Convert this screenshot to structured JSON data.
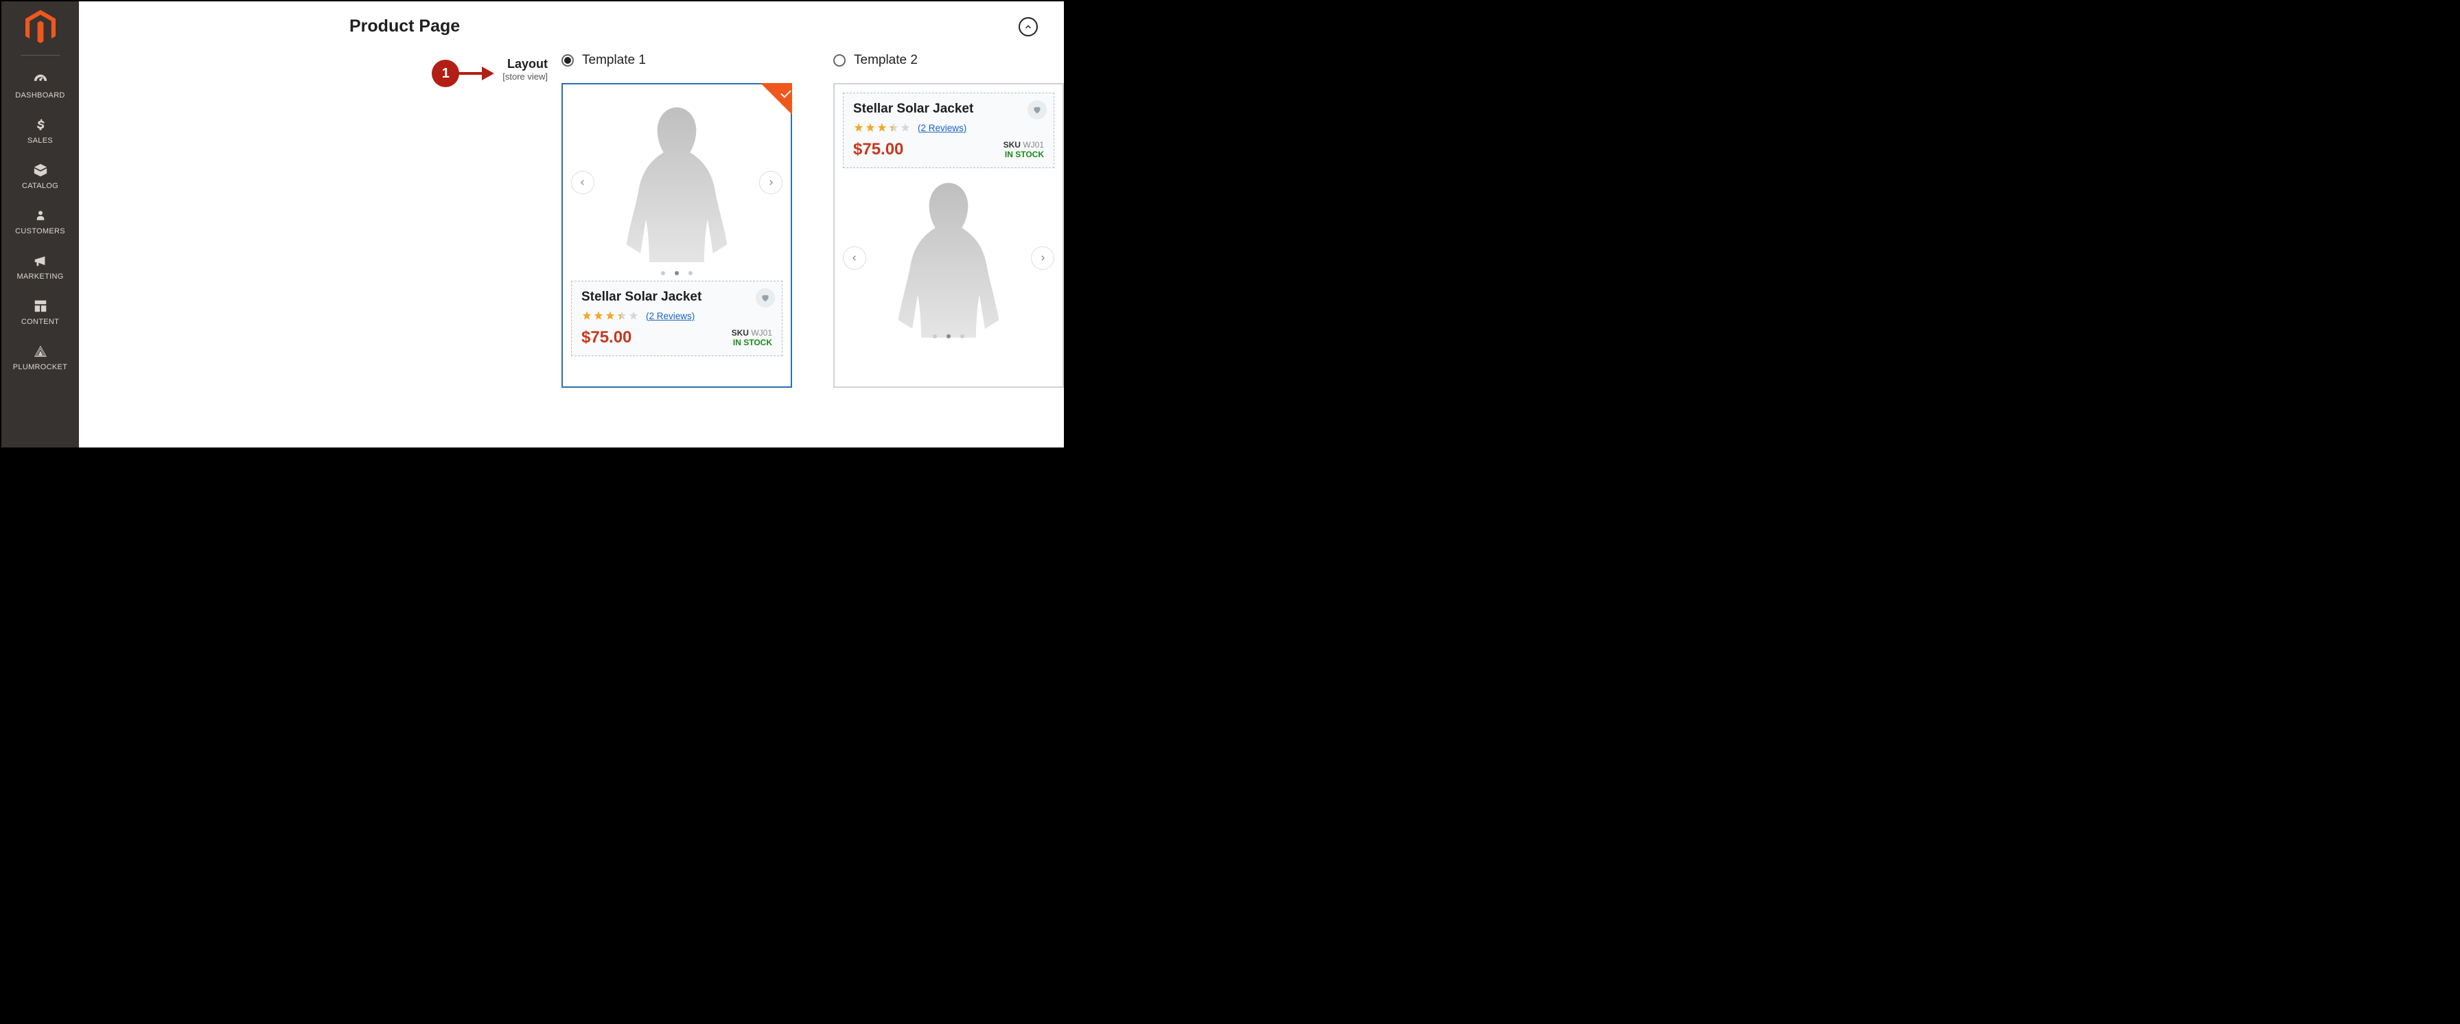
{
  "sidebar": {
    "items": [
      {
        "label": "DASHBOARD"
      },
      {
        "label": "SALES"
      },
      {
        "label": "CATALOG"
      },
      {
        "label": "CUSTOMERS"
      },
      {
        "label": "MARKETING"
      },
      {
        "label": "CONTENT"
      },
      {
        "label": "PLUMROCKET"
      }
    ]
  },
  "page": {
    "title": "Product Page",
    "callout_number": "1",
    "layout_label": "Layout",
    "layout_scope": "[store view]"
  },
  "options": {
    "template1": {
      "label": "Template 1",
      "selected": true
    },
    "template2": {
      "label": "Template 2",
      "selected": false
    }
  },
  "product": {
    "name": "Stellar Solar Jacket",
    "rating": 3.2,
    "reviews_text": "(2 Reviews)",
    "price": "$75.00",
    "sku_label": "SKU",
    "sku_value": "WJ01",
    "stock": "IN STOCK"
  }
}
